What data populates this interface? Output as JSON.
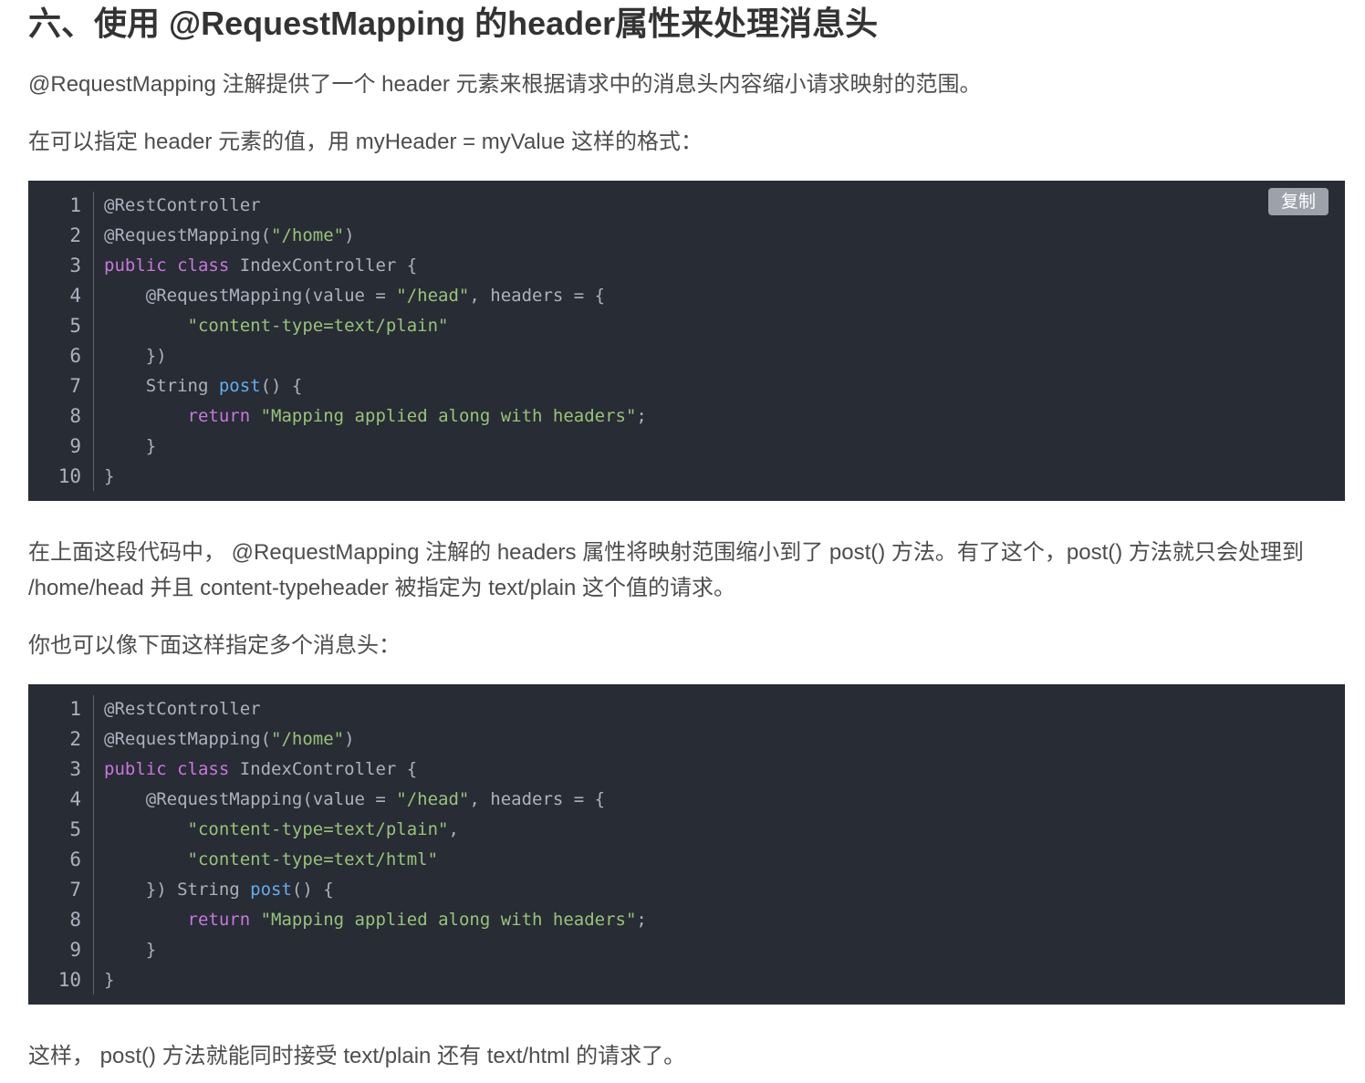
{
  "heading": "六、使用 @RequestMapping 的header属性来处理消息头",
  "para1": "@RequestMapping 注解提供了一个 header 元素来根据请求中的消息头内容缩小请求映射的范围。",
  "para2": "在可以指定 header 元素的值，用 myHeader = myValue 这样的格式：",
  "para3": "在上面这段代码中， @RequestMapping 注解的 headers 属性将映射范围缩小到了 post() 方法。有了这个，post() 方法就只会处理到 /home/head 并且 content-typeheader 被指定为 text/plain 这个值的请求。",
  "para4": "你也可以像下面这样指定多个消息头：",
  "para5": "这样， post() 方法就能同时接受 text/plain 还有 text/html 的请求了。",
  "copy_label": "复制",
  "code_block_1": [
    {
      "n": "1",
      "tokens": [
        {
          "t": "@RestController",
          "c": "an"
        }
      ]
    },
    {
      "n": "2",
      "tokens": [
        {
          "t": "@RequestMapping(",
          "c": "an"
        },
        {
          "t": "\"/home\"",
          "c": "str"
        },
        {
          "t": ")",
          "c": "an"
        }
      ]
    },
    {
      "n": "3",
      "tokens": [
        {
          "t": "public",
          "c": "kw"
        },
        {
          "t": " ",
          "c": ""
        },
        {
          "t": "class",
          "c": "kw"
        },
        {
          "t": " IndexController {",
          "c": ""
        }
      ]
    },
    {
      "n": "4",
      "tokens": [
        {
          "t": "    @RequestMapping(value = ",
          "c": "an"
        },
        {
          "t": "\"/head\"",
          "c": "str"
        },
        {
          "t": ", headers = {",
          "c": ""
        }
      ]
    },
    {
      "n": "5",
      "tokens": [
        {
          "t": "        ",
          "c": ""
        },
        {
          "t": "\"content-type=text/plain\"",
          "c": "str"
        }
      ]
    },
    {
      "n": "6",
      "tokens": [
        {
          "t": "    })",
          "c": ""
        }
      ]
    },
    {
      "n": "7",
      "tokens": [
        {
          "t": "    String ",
          "c": ""
        },
        {
          "t": "post",
          "c": "fn"
        },
        {
          "t": "() {",
          "c": ""
        }
      ]
    },
    {
      "n": "8",
      "tokens": [
        {
          "t": "        ",
          "c": ""
        },
        {
          "t": "return",
          "c": "kw"
        },
        {
          "t": " ",
          "c": ""
        },
        {
          "t": "\"Mapping applied along with headers\"",
          "c": "str"
        },
        {
          "t": ";",
          "c": ""
        }
      ]
    },
    {
      "n": "9",
      "tokens": [
        {
          "t": "    }",
          "c": ""
        }
      ]
    },
    {
      "n": "10",
      "tokens": [
        {
          "t": "}",
          "c": ""
        }
      ]
    }
  ],
  "code_block_2": [
    {
      "n": "1",
      "tokens": [
        {
          "t": "@RestController",
          "c": "an"
        }
      ]
    },
    {
      "n": "2",
      "tokens": [
        {
          "t": "@RequestMapping(",
          "c": "an"
        },
        {
          "t": "\"/home\"",
          "c": "str"
        },
        {
          "t": ")",
          "c": "an"
        }
      ]
    },
    {
      "n": "3",
      "tokens": [
        {
          "t": "public",
          "c": "kw"
        },
        {
          "t": " ",
          "c": ""
        },
        {
          "t": "class",
          "c": "kw"
        },
        {
          "t": " IndexController {",
          "c": ""
        }
      ]
    },
    {
      "n": "4",
      "tokens": [
        {
          "t": "    @RequestMapping(value = ",
          "c": "an"
        },
        {
          "t": "\"/head\"",
          "c": "str"
        },
        {
          "t": ", headers = {",
          "c": ""
        }
      ]
    },
    {
      "n": "5",
      "tokens": [
        {
          "t": "        ",
          "c": ""
        },
        {
          "t": "\"content-type=text/plain\"",
          "c": "str"
        },
        {
          "t": ",",
          "c": ""
        }
      ]
    },
    {
      "n": "6",
      "tokens": [
        {
          "t": "        ",
          "c": ""
        },
        {
          "t": "\"content-type=text/html\"",
          "c": "str"
        }
      ]
    },
    {
      "n": "7",
      "tokens": [
        {
          "t": "    }) String ",
          "c": ""
        },
        {
          "t": "post",
          "c": "fn"
        },
        {
          "t": "() {",
          "c": ""
        }
      ]
    },
    {
      "n": "8",
      "tokens": [
        {
          "t": "        ",
          "c": ""
        },
        {
          "t": "return",
          "c": "kw"
        },
        {
          "t": " ",
          "c": ""
        },
        {
          "t": "\"Mapping applied along with headers\"",
          "c": "str"
        },
        {
          "t": ";",
          "c": ""
        }
      ]
    },
    {
      "n": "9",
      "tokens": [
        {
          "t": "    }",
          "c": ""
        }
      ]
    },
    {
      "n": "10",
      "tokens": [
        {
          "t": "}",
          "c": ""
        }
      ]
    }
  ]
}
